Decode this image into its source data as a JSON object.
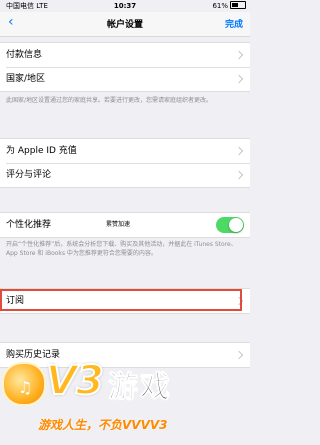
{
  "status_bar": {
    "carrier": "中国电信",
    "network": "LTE",
    "time": "10:37",
    "battery": "61%",
    "battery_level": 0.61
  },
  "nav": {
    "title": "帐户设置",
    "done": "完成"
  },
  "groups": {
    "payment": {
      "label": "付款信息"
    },
    "region": {
      "label": "国家/地区"
    },
    "region_note": "此国家/地区设置通过您的家庭共享。若要进行更改，您需请家庭组织者更改。",
    "topup": {
      "label": "为 Apple ID 充值"
    },
    "ratings": {
      "label": "评分与评论"
    },
    "personalized": {
      "label": "个性化推荐",
      "inline_text": "累赞加速",
      "enabled": true
    },
    "personalized_note": "开启“个性化推荐”后，系统会分析您下载、购买及其他活动，并据此在 iTunes Store、App Store 和 iBooks 中为您推荐更符合您需要的内容。",
    "subscriptions": {
      "label": "订阅"
    },
    "history": {
      "label": "购买历史记录"
    }
  },
  "watermark": {
    "brand": "V3",
    "brand_cn": "游戏",
    "slogan": "游戏人生，不负VVVV3"
  },
  "colors": {
    "accent": "#007aff",
    "toggle_on": "#4cd964",
    "highlight": "#e04b3a",
    "background": "#efeff4"
  }
}
